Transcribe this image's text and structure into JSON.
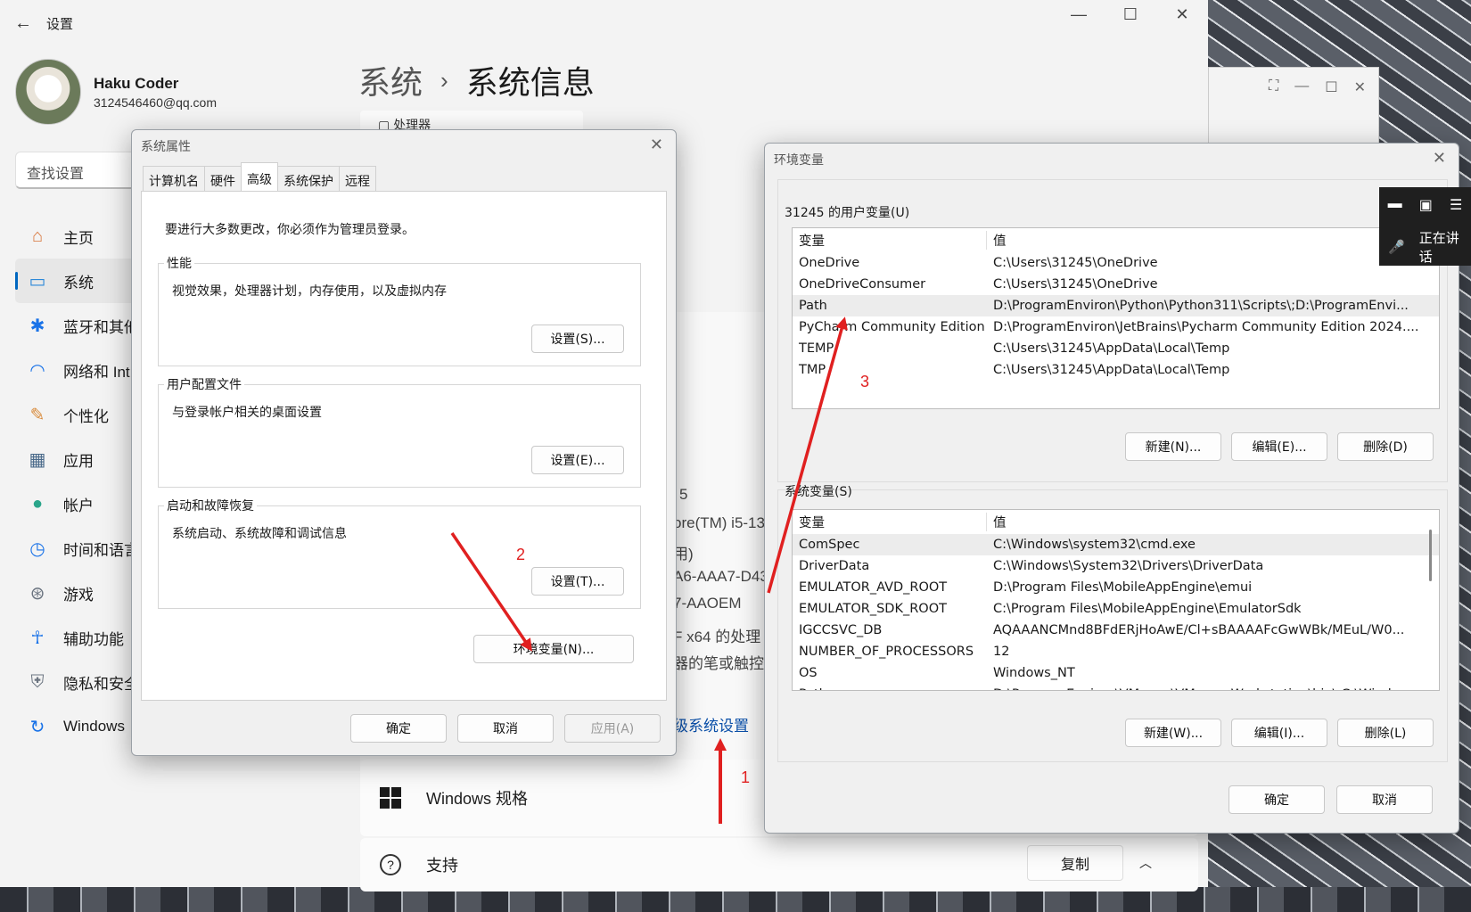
{
  "settings": {
    "app_title": "设置",
    "profile": {
      "name": "Haku Coder",
      "email": "3124546460@qq.com"
    },
    "search_placeholder": "查找设置",
    "nav": [
      {
        "label": "主页",
        "icon": "home-icon"
      },
      {
        "label": "系统",
        "icon": "system-icon",
        "active": true
      },
      {
        "label": "蓝牙和其他",
        "icon": "bluetooth-icon"
      },
      {
        "label": "网络和 Int",
        "icon": "wifi-icon"
      },
      {
        "label": "个性化",
        "icon": "brush-icon"
      },
      {
        "label": "应用",
        "icon": "apps-icon"
      },
      {
        "label": "帐户",
        "icon": "account-icon"
      },
      {
        "label": "时间和语言",
        "icon": "clock-icon"
      },
      {
        "label": "游戏",
        "icon": "gamepad-icon"
      },
      {
        "label": "辅助功能",
        "icon": "accessibility-icon"
      },
      {
        "label": "隐私和安全",
        "icon": "shield-icon"
      },
      {
        "label": "Windows",
        "icon": "update-icon"
      }
    ],
    "breadcrumb": {
      "parent": "系统",
      "current": "系统信息"
    },
    "processor_label": "处理器",
    "partial_texts": [
      "5",
      "ore(TM) i5-13",
      "用)",
      "A6-AAA7-D43",
      "7-AAOEM",
      "F x64 的处理",
      "器的笔或触控"
    ],
    "advanced_link": "级系统设置",
    "windows_spec": "Windows 规格",
    "support": "支持",
    "copy": "复制"
  },
  "sysprop": {
    "title": "系统属性",
    "tabs": [
      "计算机名",
      "硬件",
      "高级",
      "系统保护",
      "远程"
    ],
    "active_tab": "高级",
    "note": "要进行大多数更改，你必须作为管理员登录。",
    "groups": [
      {
        "title": "性能",
        "desc": "视觉效果，处理器计划，内存使用，以及虚拟内存",
        "button": "设置(S)..."
      },
      {
        "title": "用户配置文件",
        "desc": "与登录帐户相关的桌面设置",
        "button": "设置(E)..."
      },
      {
        "title": "启动和故障恢复",
        "desc": "系统启动、系统故障和调试信息",
        "button": "设置(T)..."
      }
    ],
    "env_button": "环境变量(N)...",
    "ok": "确定",
    "cancel": "取消",
    "apply": "应用(A)"
  },
  "envvars": {
    "title": "环境变量",
    "user_section": "31245 的用户变量(U)",
    "system_section": "系统变量(S)",
    "col_var": "变量",
    "col_val": "值",
    "user_vars": [
      {
        "name": "OneDrive",
        "value": "C:\\Users\\31245\\OneDrive"
      },
      {
        "name": "OneDriveConsumer",
        "value": "C:\\Users\\31245\\OneDrive"
      },
      {
        "name": "Path",
        "value": "D:\\ProgramEnviron\\Python\\Python311\\Scripts\\;D:\\ProgramEnvi...",
        "selected": true
      },
      {
        "name": "PyCharm Community Edition",
        "value": "D:\\ProgramEnviron\\JetBrains\\Pycharm Community Edition 2024...."
      },
      {
        "name": "TEMP",
        "value": "C:\\Users\\31245\\AppData\\Local\\Temp"
      },
      {
        "name": "TMP",
        "value": "C:\\Users\\31245\\AppData\\Local\\Temp"
      }
    ],
    "system_vars": [
      {
        "name": "ComSpec",
        "value": "C:\\Windows\\system32\\cmd.exe",
        "selected": true
      },
      {
        "name": "DriverData",
        "value": "C:\\Windows\\System32\\Drivers\\DriverData"
      },
      {
        "name": "EMULATOR_AVD_ROOT",
        "value": "D:\\Program Files\\MobileAppEngine\\emui"
      },
      {
        "name": "EMULATOR_SDK_ROOT",
        "value": "C:\\Program Files\\MobileAppEngine\\EmulatorSdk"
      },
      {
        "name": "IGCCSVC_DB",
        "value": "AQAAANCMnd8BFdERjHoAwE/Cl+sBAAAAFcGwWBk/MEuL/W0..."
      },
      {
        "name": "NUMBER_OF_PROCESSORS",
        "value": "12"
      },
      {
        "name": "OS",
        "value": "Windows_NT"
      },
      {
        "name": "Path",
        "value": "D:\\ProgramEnviron\\VMware\\VMware Workstation\\bin\\;C:\\Wind..."
      }
    ],
    "user_buttons": [
      "新建(N)...",
      "编辑(E)...",
      "删除(D)"
    ],
    "system_buttons": [
      "新建(W)...",
      "编辑(I)...",
      "删除(L)"
    ],
    "ok": "确定",
    "cancel": "取消"
  },
  "floatbar": {
    "text": "正在讲话"
  },
  "annotations": [
    "1",
    "2",
    "3"
  ],
  "colors": {
    "arrow": "#e02020",
    "accent": "#0067c0",
    "link": "#0a4fa8"
  }
}
